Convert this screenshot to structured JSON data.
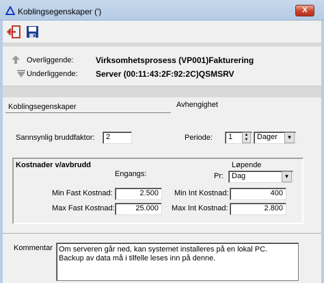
{
  "window": {
    "title": "Koblingsegenskaper  (')",
    "close_label": "X"
  },
  "toolbar": {
    "buttons": [
      {
        "icon": "exit-icon",
        "color": "#c0392b"
      },
      {
        "icon": "save-icon",
        "color": "#1f3f8f"
      }
    ]
  },
  "info": {
    "upper_label": "Overliggende:",
    "upper_value": "Virksomhetsprosess (VP001)Fakturering",
    "lower_label": "Underliggende:",
    "lower_value": "Server (00:11:43:2F:92:2C)QSMSRV"
  },
  "tabs": [
    {
      "label": "Koblingsegenskaper",
      "active": true
    },
    {
      "label": "Avhengighet",
      "active": false
    }
  ],
  "form": {
    "break_factor_label": "Sannsynlig bruddfaktor:",
    "break_factor_value": "2",
    "period_label": "Periode:",
    "period_value": "1",
    "period_unit": "Dager"
  },
  "costs": {
    "group_title": "Kostnader v/avbrudd",
    "once_header": "Engangs:",
    "running_header": "Løpende",
    "per_label": "Pr:",
    "per_value": "Dag",
    "min_fixed_label": "Min Fast Kostnad:",
    "min_fixed_value": "2.500",
    "max_fixed_label": "Max Fast Kostnad:",
    "max_fixed_value": "25.000",
    "min_int_label": "Min Int Kostnad:",
    "min_int_value": "400",
    "max_int_label": "Max Int Kostnad:",
    "max_int_value": "2.800"
  },
  "comment": {
    "label": "Kommentar",
    "line1": "Om serveren går ned, kan systemet installeres på en lokal PC.",
    "line2": "Backup av data må i tilfelle leses inn på denne."
  }
}
